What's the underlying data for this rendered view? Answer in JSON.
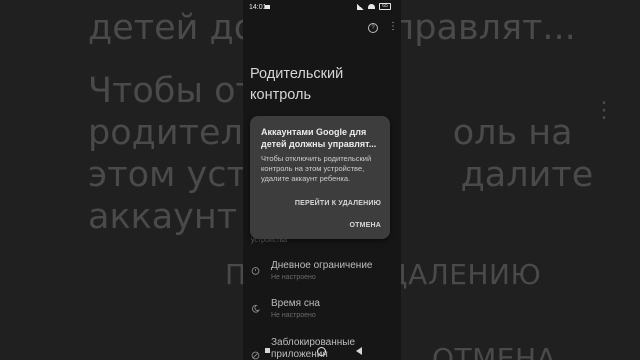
{
  "background_overlay": {
    "title_fragment": "детей должны управлят...",
    "body_lines": [
      "Чтобы отк",
      "родительс",
      "этом устра",
      "аккаунт ре"
    ],
    "body_fragments_right": [
      "оль на",
      "далите"
    ],
    "action_fragment": "ПЕ           УДАЛЕНИЮ",
    "cancel_fragment": "ОТМЕНА",
    "menu_glyph": "⋮"
  },
  "status_bar": {
    "time": "14:01",
    "battery": "65"
  },
  "app_bar": {
    "help_icon": "question-circle-icon",
    "more_icon": "more-vert-icon",
    "help_glyph": "?",
    "more_glyph": "⋮"
  },
  "page": {
    "title": "Родительский контроль",
    "partial_row_sub": "устройства",
    "rows": [
      {
        "icon": "timer-icon",
        "label": "Дневное ограничение",
        "sub": "Не настроено"
      },
      {
        "icon": "moon-icon",
        "label": "Время сна",
        "sub": "Не настроено"
      },
      {
        "icon": "block-icon",
        "label": "Заблокированные приложения",
        "sub": ""
      }
    ]
  },
  "dialog": {
    "title": "Аккаунтами Google для детей должны управлят...",
    "message": "Чтобы отключить родительский контроль на этом устройстве, удалите аккаунт ребенка.",
    "primary_button": "ПЕРЕЙТИ К УДАЛЕНИЮ",
    "cancel_button": "ОТМЕНА"
  },
  "nav_bar": {
    "recents_icon": "square-icon",
    "home_icon": "circle-icon",
    "back_icon": "triangle-back-icon"
  }
}
